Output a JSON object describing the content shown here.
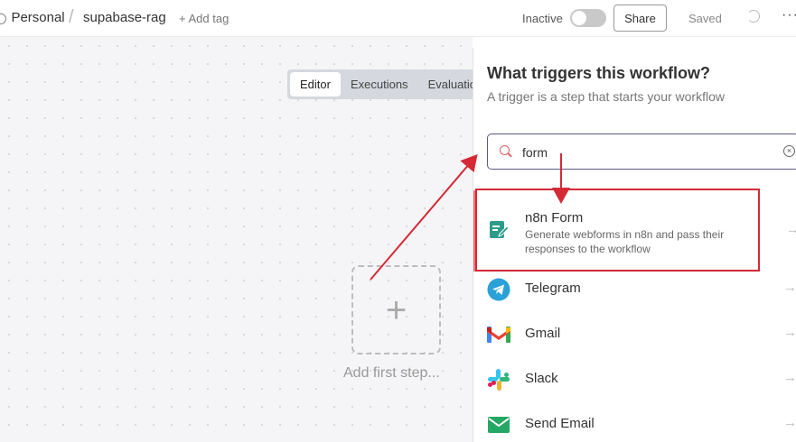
{
  "header": {
    "breadcrumb_personal": "Personal",
    "breadcrumb_sep": "/",
    "workflow_name": "supabase-rag",
    "add_tag": "+ Add tag",
    "status_label": "Inactive",
    "active": false,
    "share_label": "Share",
    "saved_label": "Saved",
    "more_label": "···"
  },
  "tabs": [
    {
      "label": "Editor",
      "active": true
    },
    {
      "label": "Executions",
      "active": false
    },
    {
      "label": "Evaluations",
      "active": false
    }
  ],
  "canvas": {
    "add_step_icon": "+",
    "add_step_label": "Add first step..."
  },
  "panel": {
    "title": "What triggers this workflow?",
    "subtitle": "A trigger is a step that starts your workflow",
    "search": {
      "value": "form",
      "clear_label": "×"
    },
    "items": [
      {
        "name": "n8n Form",
        "description": "Generate webforms in n8n and pass their responses to the workflow",
        "icon": "n8n-form-icon",
        "color": "#2e9c8a"
      },
      {
        "name": "Telegram",
        "icon": "telegram-icon",
        "color": "#2aa1d8"
      },
      {
        "name": "Gmail",
        "icon": "gmail-icon",
        "color": "#ea4335"
      },
      {
        "name": "Slack",
        "icon": "slack-icon",
        "color": "#4a154b"
      },
      {
        "name": "Send Email",
        "icon": "send-email-icon",
        "color": "#26a865"
      }
    ],
    "arrow_glyph": "→"
  },
  "annotation": {
    "color": "#d42a35"
  }
}
